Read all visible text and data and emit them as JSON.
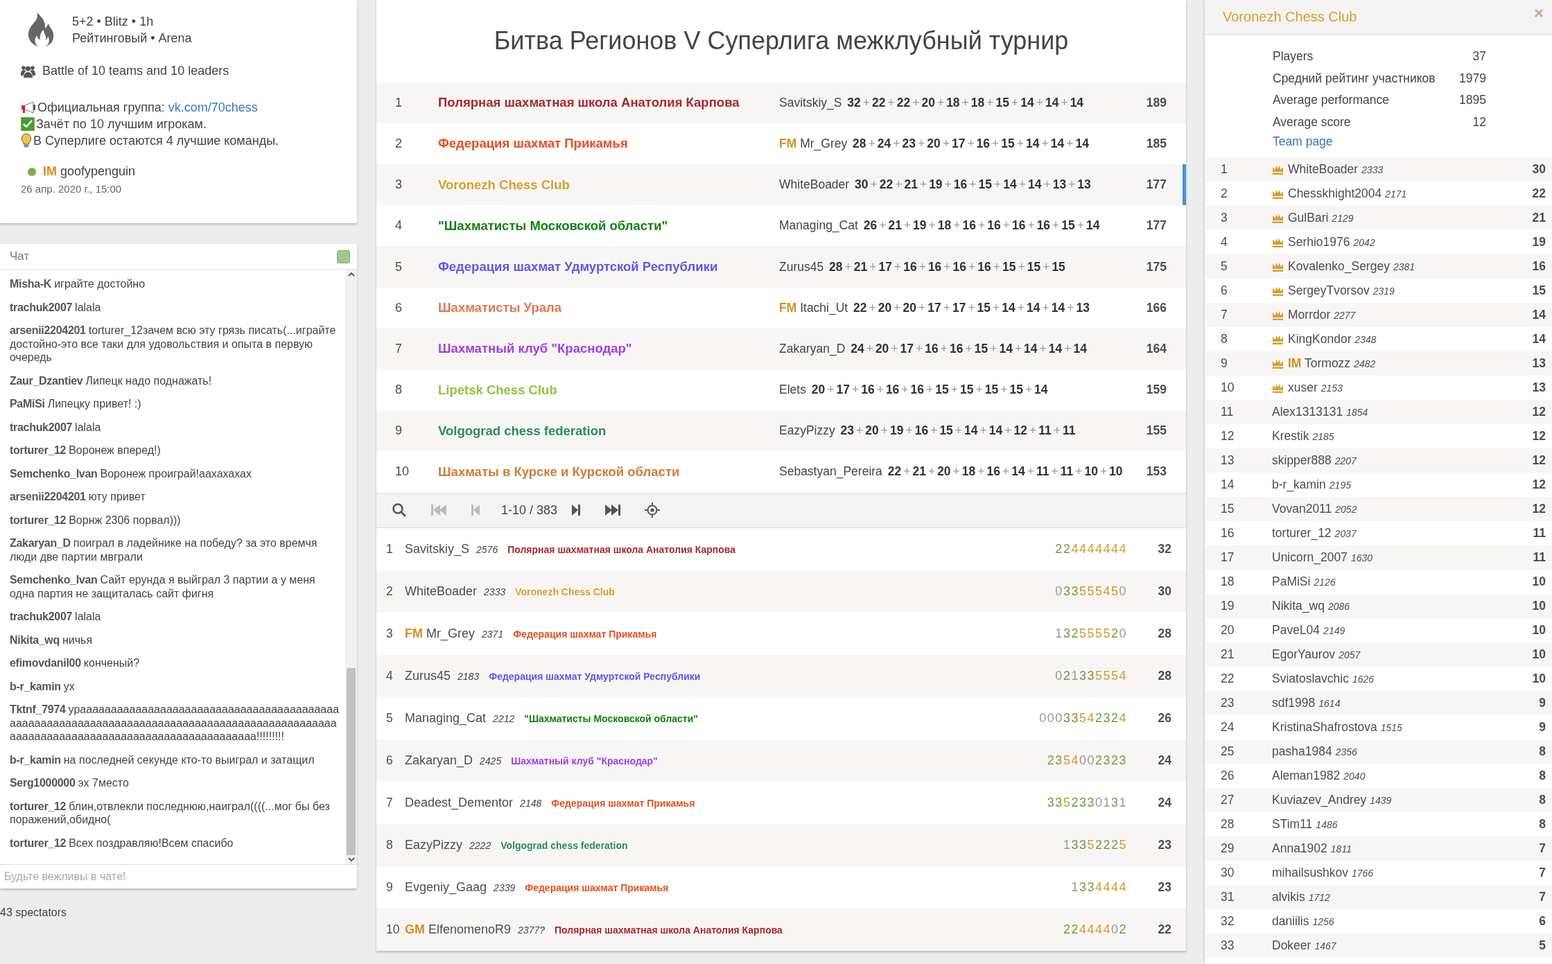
{
  "tournament": {
    "clock": "5+2 • Blitz • 1h",
    "type": "Рейтинговый • Arena",
    "description": "Battle of 10 teams and 10 leaders",
    "notes": [
      {
        "kind": "megaphone",
        "text": "Официальная группа: ",
        "link": "vk.com/70chess"
      },
      {
        "kind": "check",
        "text": "Зачёт по 10 лучшим игрокам."
      },
      {
        "kind": "bulb",
        "text": "В Суперлиге остаются 4 лучшие команды."
      }
    ],
    "creator": {
      "title": "IM",
      "name": "goofypenguin",
      "online": true
    },
    "date": "26 апр. 2020 г., 15:00"
  },
  "chat": {
    "title": "Чат",
    "enabled": true,
    "placeholder": "Будьте вежливы в чате!",
    "messages": [
      {
        "user": "Misha-K",
        "text": "играйте достойно"
      },
      {
        "user": "trachuk2007",
        "text": "lalala"
      },
      {
        "user": "arsenii2204201",
        "text": "torturer_12зачем всю эту грязь писать(...играйте достойно-это все таки для удовольствия и опыта в первую очередь"
      },
      {
        "user": "Zaur_Dzantiev",
        "text": "Липецк надо поднажать!"
      },
      {
        "user": "PaMiSi",
        "text": "Липецку привет! :)"
      },
      {
        "user": "trachuk2007",
        "text": "lalala"
      },
      {
        "user": "torturer_12",
        "text": "Воронеж вперед!)"
      },
      {
        "user": "Semchenko_Ivan",
        "text": "Воронеж проиграй!аахахахах"
      },
      {
        "user": "arsenii2204201",
        "text": "юту привет"
      },
      {
        "user": "torturer_12",
        "text": "Ворнж 2306 порвал)))"
      },
      {
        "user": "Zakaryan_D",
        "text": "поиграл в ладейнике на победу? за это времчя люди две партии мвграли"
      },
      {
        "user": "Semchenko_Ivan",
        "text": "Сайт ерунда я выйграл 3 партии а у меня одна партия не защиталась сайт фигня"
      },
      {
        "user": "trachuk2007",
        "text": "lalala"
      },
      {
        "user": "Nikita_wq",
        "text": "ничья"
      },
      {
        "user": "efimovdanil00",
        "text": "конченый?"
      },
      {
        "user": "b-r_kamin",
        "text": "ух"
      },
      {
        "user": "Tktnf_7974",
        "text": "урааааааааааааааааааааааааааааааааааааааааааааааааааааааааааааааааааааааааааааааааааааааааааааааааааааааааааааааааааааааааааааааааааааааа!!!!!!!!!"
      },
      {
        "user": "b-r_kamin",
        "text": "на последней секунде кто-то выиграл и затащил"
      },
      {
        "user": "Serg1000000",
        "text": "эх 7место"
      },
      {
        "user": "torturer_12",
        "text": "блин,отвлекли последнюю,наиграл((((...мог бы без поражений,обидно("
      },
      {
        "user": "torturer_12",
        "text": "Всех поздравляю!Всем спасибо"
      }
    ]
  },
  "spectators": "43 spectators",
  "battle": {
    "title": "Битва Регионов V Суперлига межклубный турнир",
    "teams": [
      {
        "rank": "1",
        "name": "Полярная шахматная школа Анатолия Карпова",
        "color": "#a8292b",
        "leader": {
          "name": "Savitskiy_S"
        },
        "scores": "**32**+**22**+**22**+**20**+**18**+**18**+**15**+**14**+**14**+**14**",
        "total": "189",
        "selected": false
      },
      {
        "rank": "2",
        "name": "Федерация шахмат Прикамья",
        "color": "#e5501c",
        "leader": {
          "title": "FM",
          "name": "Mr_Grey"
        },
        "scores": "**28**+**24**+**23**+**20**+**17**+**16**+**15**+**14**+**14**+**14**",
        "total": "185",
        "selected": false
      },
      {
        "rank": "3",
        "name": "Voronezh Chess Club",
        "color": "#d6a030",
        "leader": {
          "name": "WhiteBoader"
        },
        "scores": "**30**+**22**+**21**+**19**+**16**+**15**+**14**+**14**+**13**+**13**",
        "total": "177",
        "selected": true
      },
      {
        "rank": "4",
        "name": "\"Шахматисты Московской области\"",
        "color": "#128012",
        "leader": {
          "name": "Managing_Cat"
        },
        "scores": "**26**+**21**+**19**+**18**+**16**+**16**+**16**+**16**+**15**+**14**",
        "total": "177",
        "selected": false
      },
      {
        "rank": "5",
        "name": "Федерация шахмат Удмуртской Республики",
        "color": "#5a5ae8",
        "leader": {
          "name": "Zurus45"
        },
        "scores": "**28**+**21**+**17**+**16**+**16**+**16**+**16**+**15**+**15**+**15**",
        "total": "175",
        "selected": false
      },
      {
        "rank": "6",
        "name": "Шахматисты Урала",
        "color": "#e47552",
        "leader": {
          "title": "FM",
          "name": "Itachi_Ut"
        },
        "scores": "**22**+**20**+**20**+**17**+**17**+**15**+**14**+**14**+**14**+**13**",
        "total": "166",
        "selected": false
      },
      {
        "rank": "7",
        "name": "Шахматный клуб \"Краснодар\"",
        "color": "#a23ee6",
        "leader": {
          "name": "Zakaryan_D"
        },
        "scores": "**24**+**20**+**17**+**16**+**16**+**15**+**14**+**14**+**14**+**14**",
        "total": "164",
        "selected": false
      },
      {
        "rank": "8",
        "name": "Lipetsk Chess Club",
        "color": "#8cc63f",
        "leader": {
          "name": "Elets"
        },
        "scores": "**20**+**17**+**16**+**16**+**16**+**15**+**15**+**15**+**15**+**14**",
        "total": "159",
        "selected": false
      },
      {
        "rank": "9",
        "name": "Volgograd chess federation",
        "color": "#2e8b57",
        "leader": {
          "name": "EazyPizzy"
        },
        "scores": "**23**+**20**+**19**+**16**+**15**+**14**+**14**+**12**+**11**+**11**",
        "total": "155",
        "selected": false
      },
      {
        "rank": "10",
        "name": "Шахматы в Курске и Курской области",
        "color": "#cf7d35",
        "leader": {
          "name": "Sebastyan_Pereira"
        },
        "scores": "**22**+**21**+**20**+**18**+**16**+**14**+**11**+**11**+**10**+**10**",
        "total": "153",
        "selected": false
      }
    ],
    "pager": [
      {
        "kind": "search",
        "disabled": false
      },
      {
        "kind": "first",
        "disabled": true
      },
      {
        "kind": "prev",
        "disabled": true
      },
      {
        "kind": "range",
        "text": "1-10 / 383"
      },
      {
        "kind": "next",
        "disabled": false
      },
      {
        "kind": "last",
        "disabled": false
      },
      {
        "kind": "locate",
        "disabled": false
      }
    ],
    "players": [
      {
        "rank": "1",
        "name": "Savitskiy_S",
        "rating": "2576",
        "team": "Полярная шахматная школа Анатолия Карпова",
        "color": "#a8292b",
        "sheet": "224444444",
        "score": "32"
      },
      {
        "rank": "2",
        "name": "WhiteBoader",
        "rating": "2333",
        "team": "Voronezh Chess Club",
        "color": "#d6a030",
        "sheet": "033555450",
        "score": "30"
      },
      {
        "rank": "3",
        "title": "FM",
        "name": "Mr_Grey",
        "rating": "2371",
        "team": "Федерация шахмат Прикамья",
        "color": "#e5501c",
        "sheet": "132555520",
        "score": "28"
      },
      {
        "rank": "4",
        "name": "Zurus45",
        "rating": "2183",
        "team": "Федерация шахмат Удмуртской Республики",
        "color": "#5a5ae8",
        "sheet": "021335554",
        "score": "28"
      },
      {
        "rank": "5",
        "name": "Managing_Cat",
        "rating": "2212",
        "team": "\"Шахматисты Московской области\"",
        "color": "#128012",
        "sheet": "00033542324",
        "score": "26"
      },
      {
        "rank": "6",
        "name": "Zakaryan_D",
        "rating": "2425",
        "team": "Шахматный клуб \"Краснодар\"",
        "color": "#a23ee6",
        "sheet": "2354002323",
        "score": "24"
      },
      {
        "rank": "7",
        "name": "Deadest_Dementor",
        "rating": "2148",
        "team": "Федерация шахмат Прикамья",
        "color": "#e5501c",
        "sheet": "3352330131",
        "score": "24"
      },
      {
        "rank": "8",
        "name": "EazyPizzy",
        "rating": "2222",
        "team": "Volgograd chess federation",
        "color": "#2e8b57",
        "sheet": "13352225",
        "score": "23"
      },
      {
        "rank": "9",
        "name": "Evgeniy_Gaag",
        "rating": "2339",
        "team": "Федерация шахмат Прикамья",
        "color": "#e5501c",
        "sheet": "1334444",
        "score": "23"
      },
      {
        "rank": "10",
        "title": "GM",
        "name": "ElfenomenoR9",
        "rating": "2377?",
        "team": "Полярная шахматная школа Анатолия Карпова",
        "color": "#a8292b",
        "sheet": "22444402",
        "score": "22"
      }
    ]
  },
  "team_panel": {
    "name": "Voronezh Chess Club",
    "color": "#d6a030",
    "close": "×",
    "stats": [
      {
        "label": "Players",
        "value": "37"
      },
      {
        "label": "Средний рейтинг участников",
        "value": "1979"
      },
      {
        "label": "Average performance",
        "value": "1895"
      },
      {
        "label": "Average score",
        "value": "12"
      }
    ],
    "link": "Team page",
    "players": [
      {
        "rank": "1",
        "leader": true,
        "name": "WhiteBoader",
        "rating": "2333",
        "score": "30"
      },
      {
        "rank": "2",
        "leader": true,
        "name": "Chesskhight2004",
        "rating": "2171",
        "score": "22"
      },
      {
        "rank": "3",
        "leader": true,
        "name": "GulBari",
        "rating": "2129",
        "score": "21"
      },
      {
        "rank": "4",
        "leader": true,
        "name": "Serhio1976",
        "rating": "2042",
        "score": "19"
      },
      {
        "rank": "5",
        "leader": true,
        "name": "Kovalenko_Sergey",
        "rating": "2381",
        "score": "16"
      },
      {
        "rank": "6",
        "leader": true,
        "name": "SergeyTvorsov",
        "rating": "2319",
        "score": "15"
      },
      {
        "rank": "7",
        "leader": true,
        "name": "Morrdor",
        "rating": "2277",
        "score": "14"
      },
      {
        "rank": "8",
        "leader": true,
        "name": "KingKondor",
        "rating": "2348",
        "score": "14"
      },
      {
        "rank": "9",
        "leader": true,
        "title": "IM",
        "name": "Tormozz",
        "rating": "2482",
        "score": "13"
      },
      {
        "rank": "10",
        "leader": true,
        "name": "xuser",
        "rating": "2153",
        "score": "13"
      },
      {
        "rank": "11",
        "leader": false,
        "name": "Alex1313131",
        "rating": "1854",
        "score": "12"
      },
      {
        "rank": "12",
        "leader": false,
        "name": "Krestik",
        "rating": "2185",
        "score": "12"
      },
      {
        "rank": "13",
        "leader": false,
        "name": "skipper888",
        "rating": "2207",
        "score": "12"
      },
      {
        "rank": "14",
        "leader": false,
        "name": "b-r_kamin",
        "rating": "2195",
        "score": "12"
      },
      {
        "rank": "15",
        "leader": false,
        "name": "Vovan2011",
        "rating": "2052",
        "score": "12"
      },
      {
        "rank": "16",
        "leader": false,
        "name": "torturer_12",
        "rating": "2037",
        "score": "11"
      },
      {
        "rank": "17",
        "leader": false,
        "name": "Unicorn_2007",
        "rating": "1630",
        "score": "11"
      },
      {
        "rank": "18",
        "leader": false,
        "name": "PaMiSi",
        "rating": "2126",
        "score": "10"
      },
      {
        "rank": "19",
        "leader": false,
        "name": "Nikita_wq",
        "rating": "2086",
        "score": "10"
      },
      {
        "rank": "20",
        "leader": false,
        "name": "PaveL04",
        "rating": "2149",
        "score": "10"
      },
      {
        "rank": "21",
        "leader": false,
        "name": "EgorYaurov",
        "rating": "2057",
        "score": "10"
      },
      {
        "rank": "22",
        "leader": false,
        "name": "Sviatoslavchic",
        "rating": "1626",
        "score": "10"
      },
      {
        "rank": "23",
        "leader": false,
        "name": "sdf1998",
        "rating": "1614",
        "score": "9"
      },
      {
        "rank": "24",
        "leader": false,
        "name": "KristinaShafrostova",
        "rating": "1515",
        "score": "9"
      },
      {
        "rank": "25",
        "leader": false,
        "name": "pasha1984",
        "rating": "2356",
        "score": "8"
      },
      {
        "rank": "26",
        "leader": false,
        "name": "Aleman1982",
        "rating": "2040",
        "score": "8"
      },
      {
        "rank": "27",
        "leader": false,
        "name": "Kuviazev_Andrey",
        "rating": "1439",
        "score": "8"
      },
      {
        "rank": "28",
        "leader": false,
        "name": "STim11",
        "rating": "1486",
        "score": "8"
      },
      {
        "rank": "29",
        "leader": false,
        "name": "Anna1902",
        "rating": "1811",
        "score": "7"
      },
      {
        "rank": "30",
        "leader": false,
        "name": "mihailsushkov",
        "rating": "1766",
        "score": "7"
      },
      {
        "rank": "31",
        "leader": false,
        "name": "alvikis",
        "rating": "1712",
        "score": "7"
      },
      {
        "rank": "32",
        "leader": false,
        "name": "daniilis",
        "rating": "1256",
        "score": "6"
      },
      {
        "rank": "33",
        "leader": false,
        "name": "Dokeer",
        "rating": "1467",
        "score": "5"
      }
    ]
  }
}
